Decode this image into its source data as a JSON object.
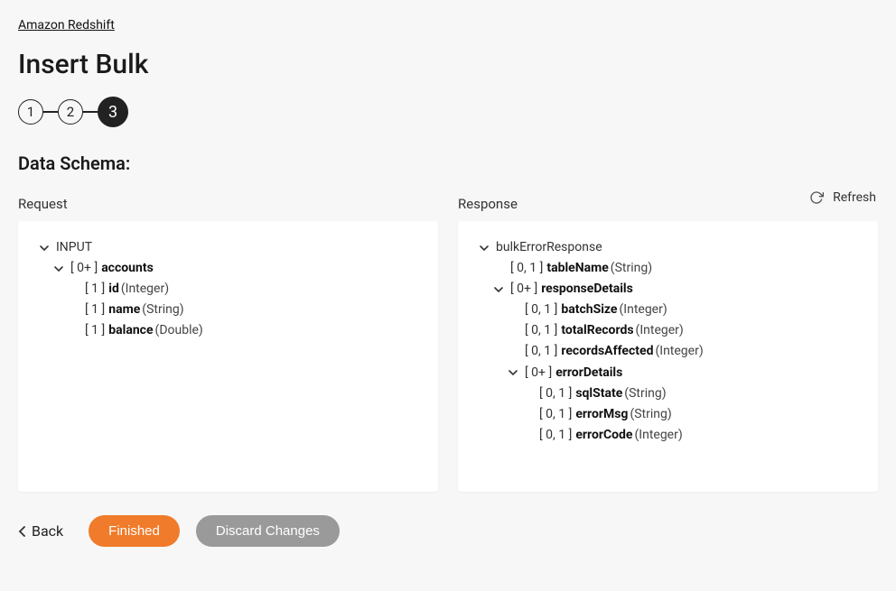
{
  "breadcrumb": "Amazon Redshift",
  "page_title": "Insert Bulk",
  "stepper": {
    "s1": "1",
    "s2": "2",
    "s3": "3"
  },
  "section_title": "Data Schema:",
  "refresh_label": "Refresh",
  "request": {
    "label": "Request",
    "root": "INPUT",
    "accounts_card": "[ 0+ ]",
    "accounts_name": "accounts",
    "fields": {
      "id": {
        "card": "[ 1 ]",
        "name": "id",
        "type": "(Integer)"
      },
      "name": {
        "card": "[ 1 ]",
        "name": "name",
        "type": "(String)"
      },
      "balance": {
        "card": "[ 1 ]",
        "name": "balance",
        "type": "(Double)"
      }
    }
  },
  "response": {
    "label": "Response",
    "root": "bulkErrorResponse",
    "tableName": {
      "card": "[ 0, 1 ]",
      "name": "tableName",
      "type": "(String)"
    },
    "responseDetails_card": "[ 0+ ]",
    "responseDetails_name": "responseDetails",
    "batchSize": {
      "card": "[ 0, 1 ]",
      "name": "batchSize",
      "type": "(Integer)"
    },
    "totalRecords": {
      "card": "[ 0, 1 ]",
      "name": "totalRecords",
      "type": "(Integer)"
    },
    "recordsAffected": {
      "card": "[ 0, 1 ]",
      "name": "recordsAffected",
      "type": "(Integer)"
    },
    "errorDetails_card": "[ 0+ ]",
    "errorDetails_name": "errorDetails",
    "sqlState": {
      "card": "[ 0, 1 ]",
      "name": "sqlState",
      "type": "(String)"
    },
    "errorMsg": {
      "card": "[ 0, 1 ]",
      "name": "errorMsg",
      "type": "(String)"
    },
    "errorCode": {
      "card": "[ 0, 1 ]",
      "name": "errorCode",
      "type": "(Integer)"
    }
  },
  "footer": {
    "back": "Back",
    "finished": "Finished",
    "discard": "Discard Changes"
  }
}
